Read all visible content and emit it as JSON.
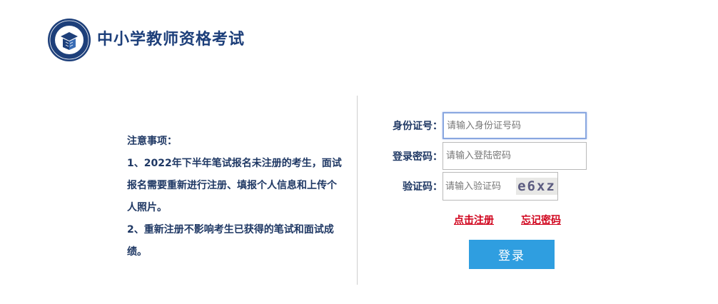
{
  "header": {
    "title": "中小学教师资格考试",
    "logo_icon": "teacher-certification-seal-icon",
    "brand_color": "#1d3f7a"
  },
  "notice": {
    "heading": "注意事项：",
    "items": [
      "1、2022年下半年笔试报名未注册的考生，面试报名需要重新进行注册、填报个人信息和上传个人照片。",
      "2、重新注册不影响考生已获得的笔试和面试成绩。"
    ]
  },
  "form": {
    "id_label": "身份证号：",
    "id_placeholder": "请输入身份证号码",
    "password_label": "登录密码：",
    "password_placeholder": "请输入登陆密码",
    "captcha_label": "验证码：",
    "captcha_placeholder": "请输入验证码",
    "captcha_text": "e6xz"
  },
  "links": {
    "register": "点击注册",
    "forgot_password": "忘记密码"
  },
  "login_button": "登录",
  "colors": {
    "link": "#d0021b",
    "button": "#2f9ee0",
    "text": "#1f3864"
  }
}
